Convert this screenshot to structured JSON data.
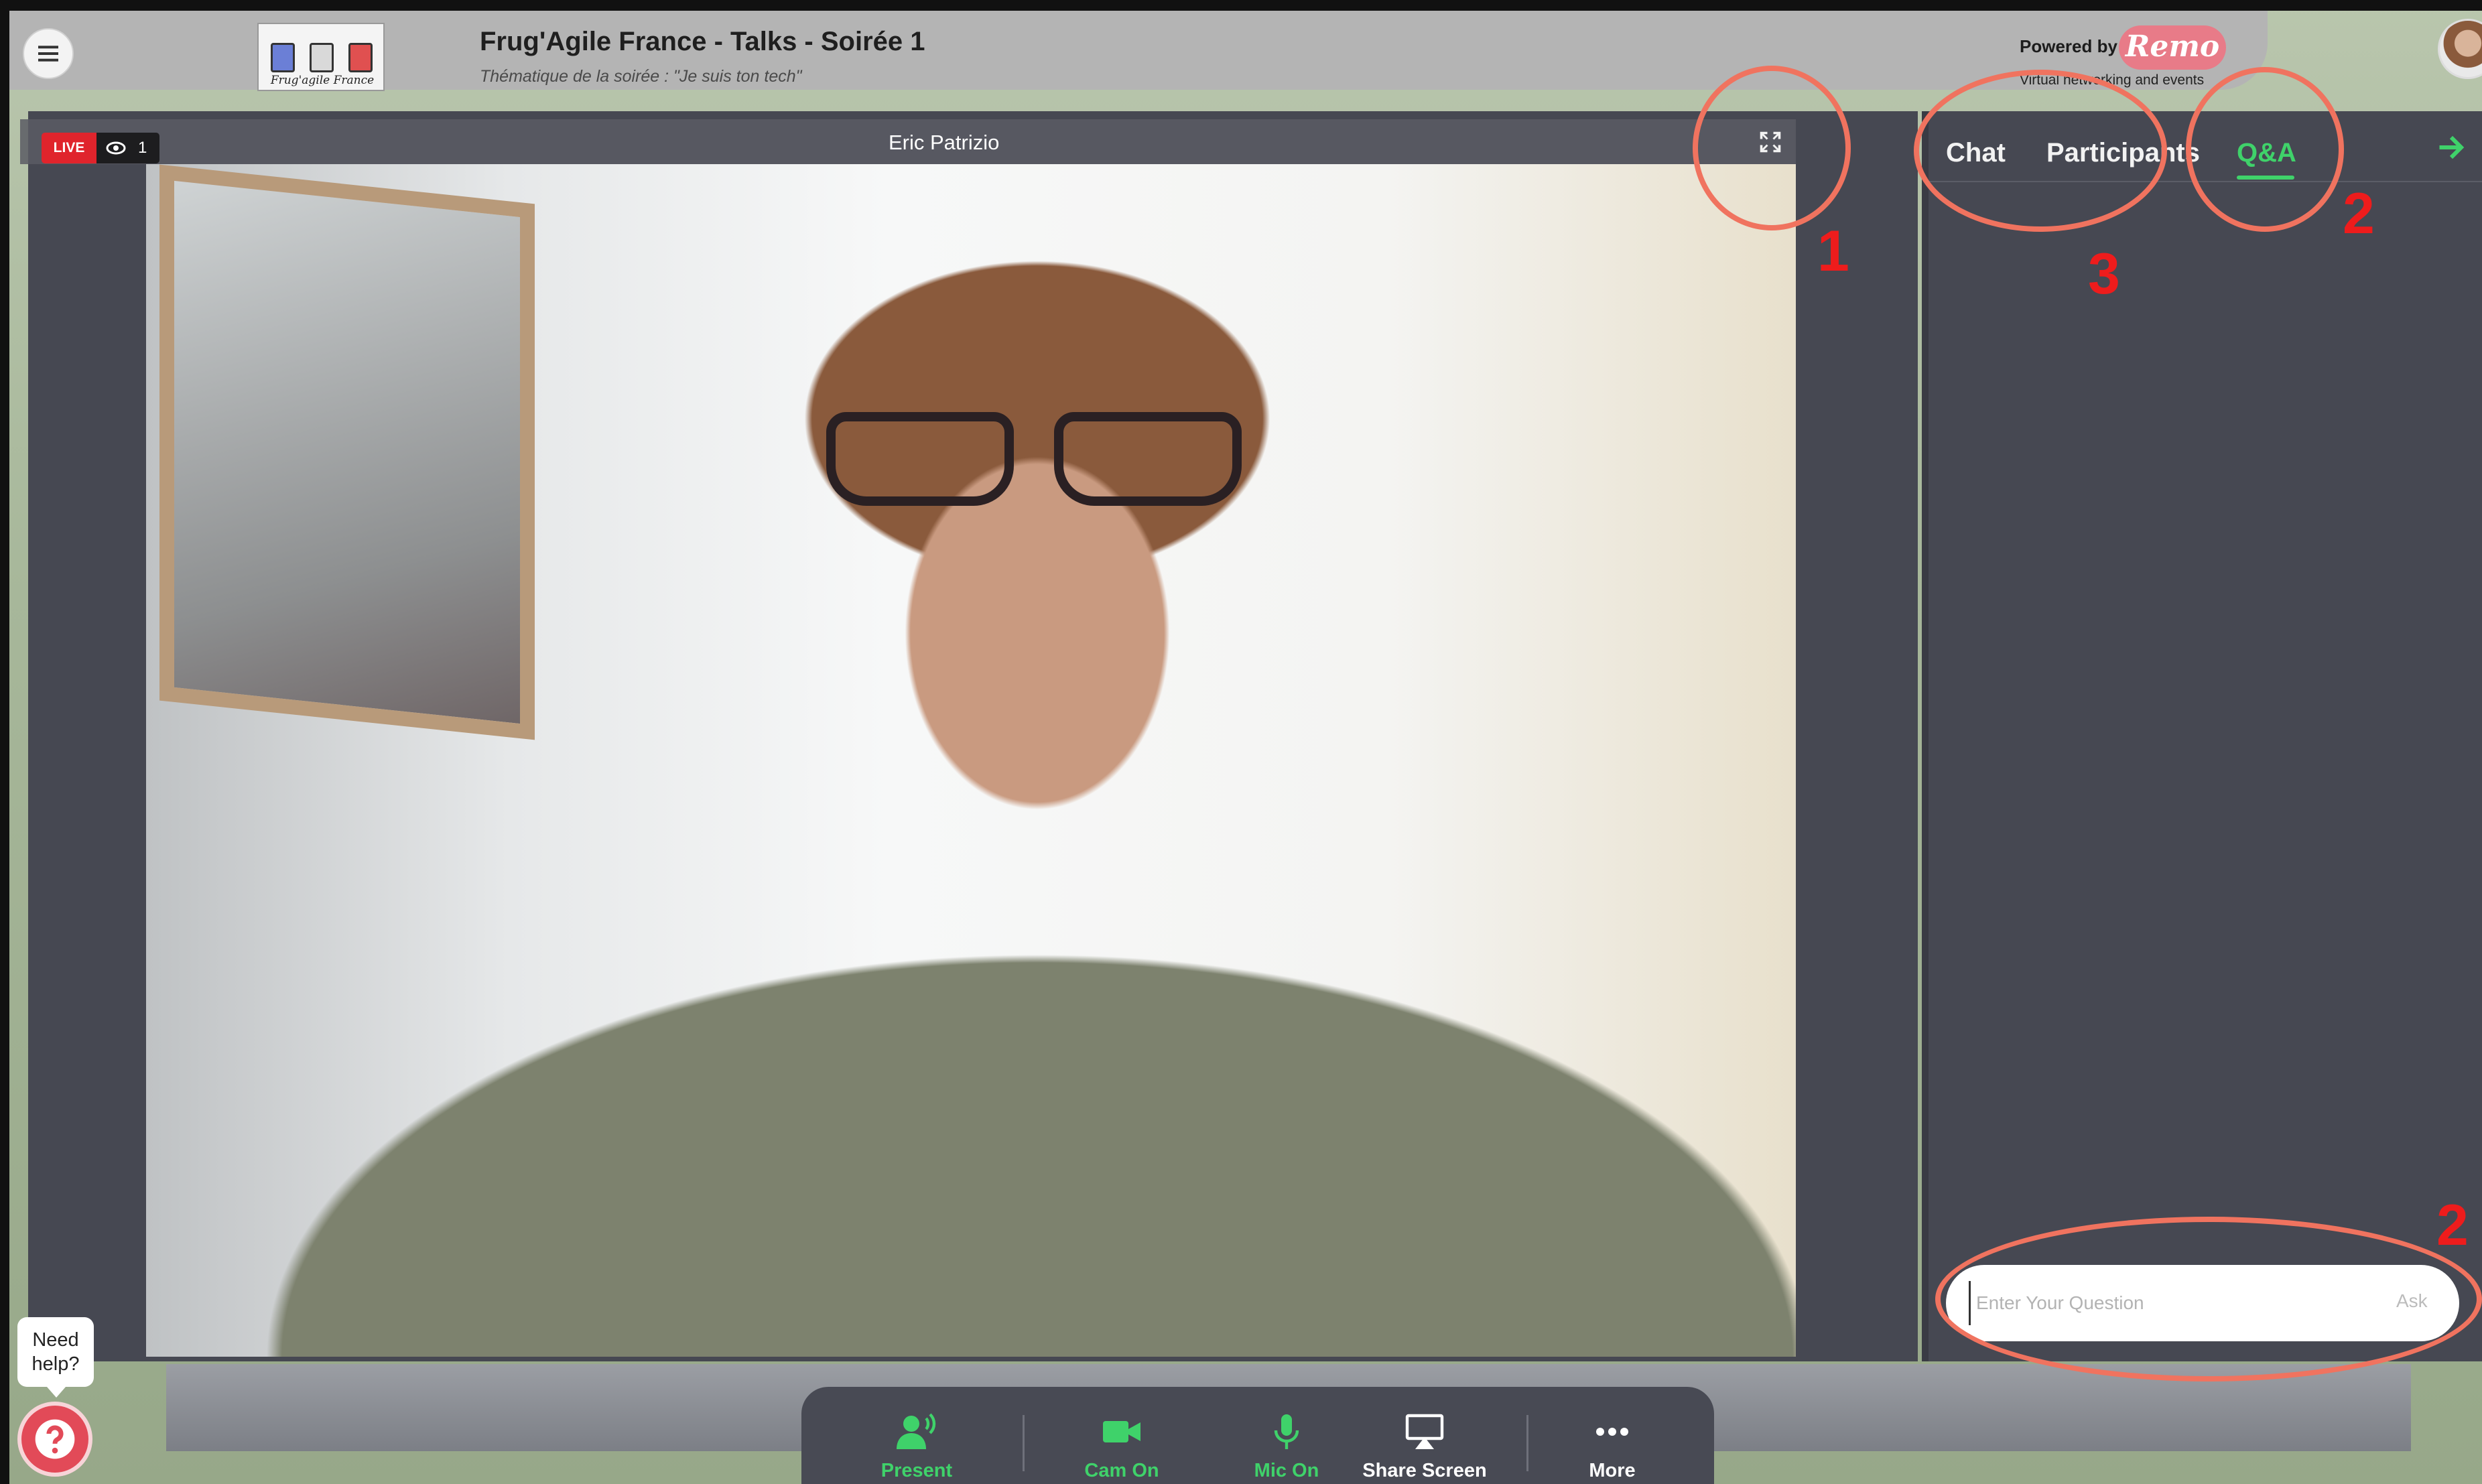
{
  "header": {
    "event_title": "Frug'Agile France - Talks - Soirée 1",
    "event_subtitle": "Thématique de la soirée : \"Je suis ton tech\"",
    "logo_text": "Frug'agile France",
    "powered_by": "Powered by",
    "brand": "Remo",
    "brand_tagline": "Virtual networking and events"
  },
  "stage": {
    "live_label": "LIVE",
    "viewer_count": "1",
    "speaker_name": "Eric Patrizio"
  },
  "panel": {
    "tabs": [
      {
        "label": "Chat"
      },
      {
        "label": "Participants"
      },
      {
        "label": "Q&A"
      }
    ],
    "active_tab": "Q&A",
    "question_placeholder": "Enter Your Question",
    "ask_label": "Ask"
  },
  "controls": {
    "present": "Present",
    "cam": "Cam On",
    "mic": "Mic On",
    "share": "Share Screen",
    "more": "More"
  },
  "help": {
    "line1": "Need",
    "line2": "help?"
  },
  "annotations": [
    "1",
    "2",
    "3",
    "2"
  ],
  "colors": {
    "accent_green": "#3fd26a",
    "live_red": "#e0242c",
    "annotation_red": "#ee1c1c",
    "panel_bg": "#464852"
  }
}
